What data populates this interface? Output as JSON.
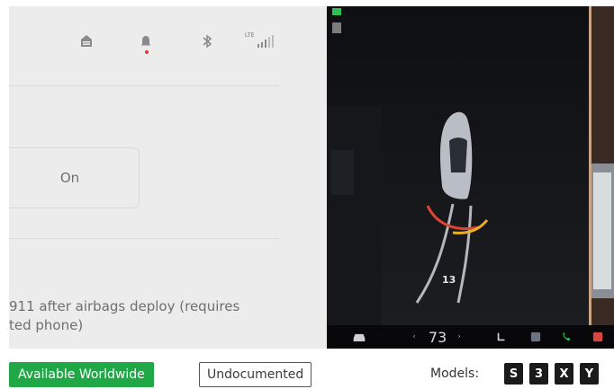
{
  "settings": {
    "status_bar": {
      "icons": [
        "home-icon",
        "bell-icon",
        "bluetooth-icon",
        "lte-signal-icon"
      ],
      "lte_label": "LTE"
    },
    "toggle_button_label": "On",
    "description_lines": [
      "911 after airbags deploy (requires",
      "ted phone)"
    ]
  },
  "camera_view": {
    "distance_label": "13",
    "speed": "73",
    "bottom_icons": [
      "car-icon",
      "chevron-left-icon",
      "chevron-right-icon",
      "seat-heater-icon",
      "app-icon",
      "phone-icon",
      "media-icon"
    ]
  },
  "footer": {
    "availability_badge": "Available Worldwide",
    "documentation_badge": "Undocumented",
    "models_label": "Models:",
    "models": [
      "S",
      "3",
      "X",
      "Y"
    ],
    "colors": {
      "available": "#1fa845",
      "model_chip": "#1a1a1a"
    }
  }
}
